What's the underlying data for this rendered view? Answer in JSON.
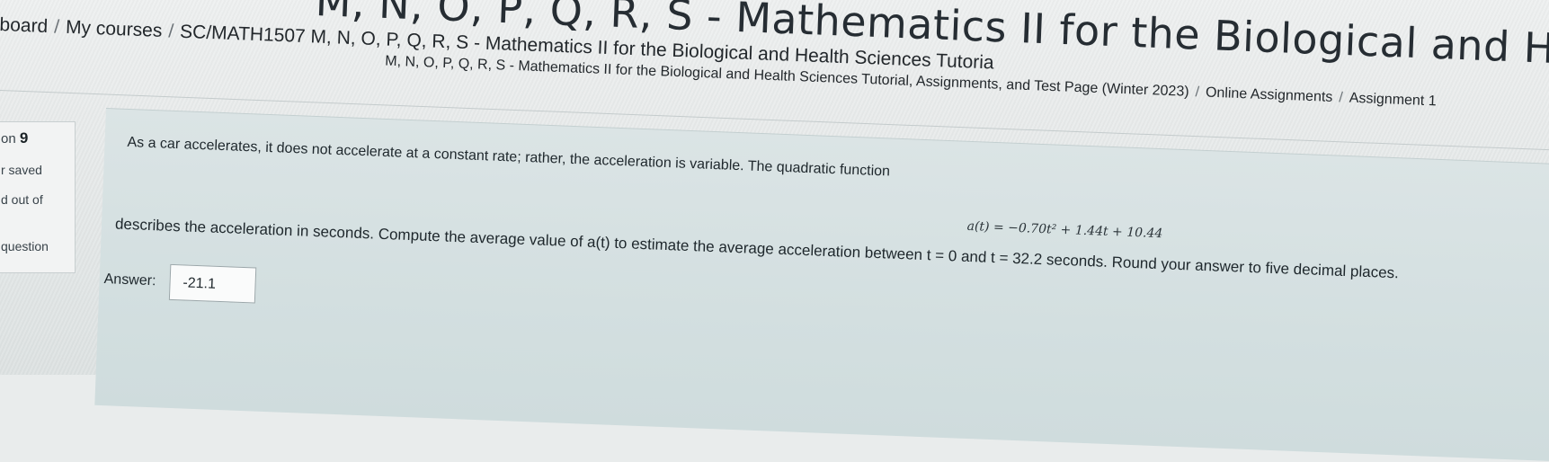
{
  "header": {
    "title_fragment": "M, N, O, P, Q, R, S - Mathematics II for the Biological and Health Sciences Tutoria"
  },
  "breadcrumb": {
    "items": [
      "board",
      "My courses",
      "SC/MATH1507 M, N, O, P, Q, R, S - Mathematics II for the Biological and Health Sciences Tutoria",
      "M, N, O, P, Q, R, S - Mathematics II for the Biological and Health Sciences Tutorial, Assignments, and Test Page (Winter 2023)",
      "Online Assignments",
      "Assignment 1"
    ],
    "separator": "/"
  },
  "question_info": {
    "prefix": "on",
    "number": "9",
    "status": "r saved",
    "marked": "d out of",
    "flag": "question"
  },
  "question": {
    "text_1": "As a car accelerates, it does not accelerate at a constant rate; rather, the acceleration is variable. The quadratic function",
    "formula": "a(t) = −0.70t² + 1.44t + 10.44",
    "text_2": "describes the acceleration in seconds. Compute the average value of a(t) to estimate the average acceleration between t = 0 and t = 32.2 seconds. Round your answer to five decimal places.",
    "answer_label": "Answer:",
    "answer_value": "-21.1"
  }
}
